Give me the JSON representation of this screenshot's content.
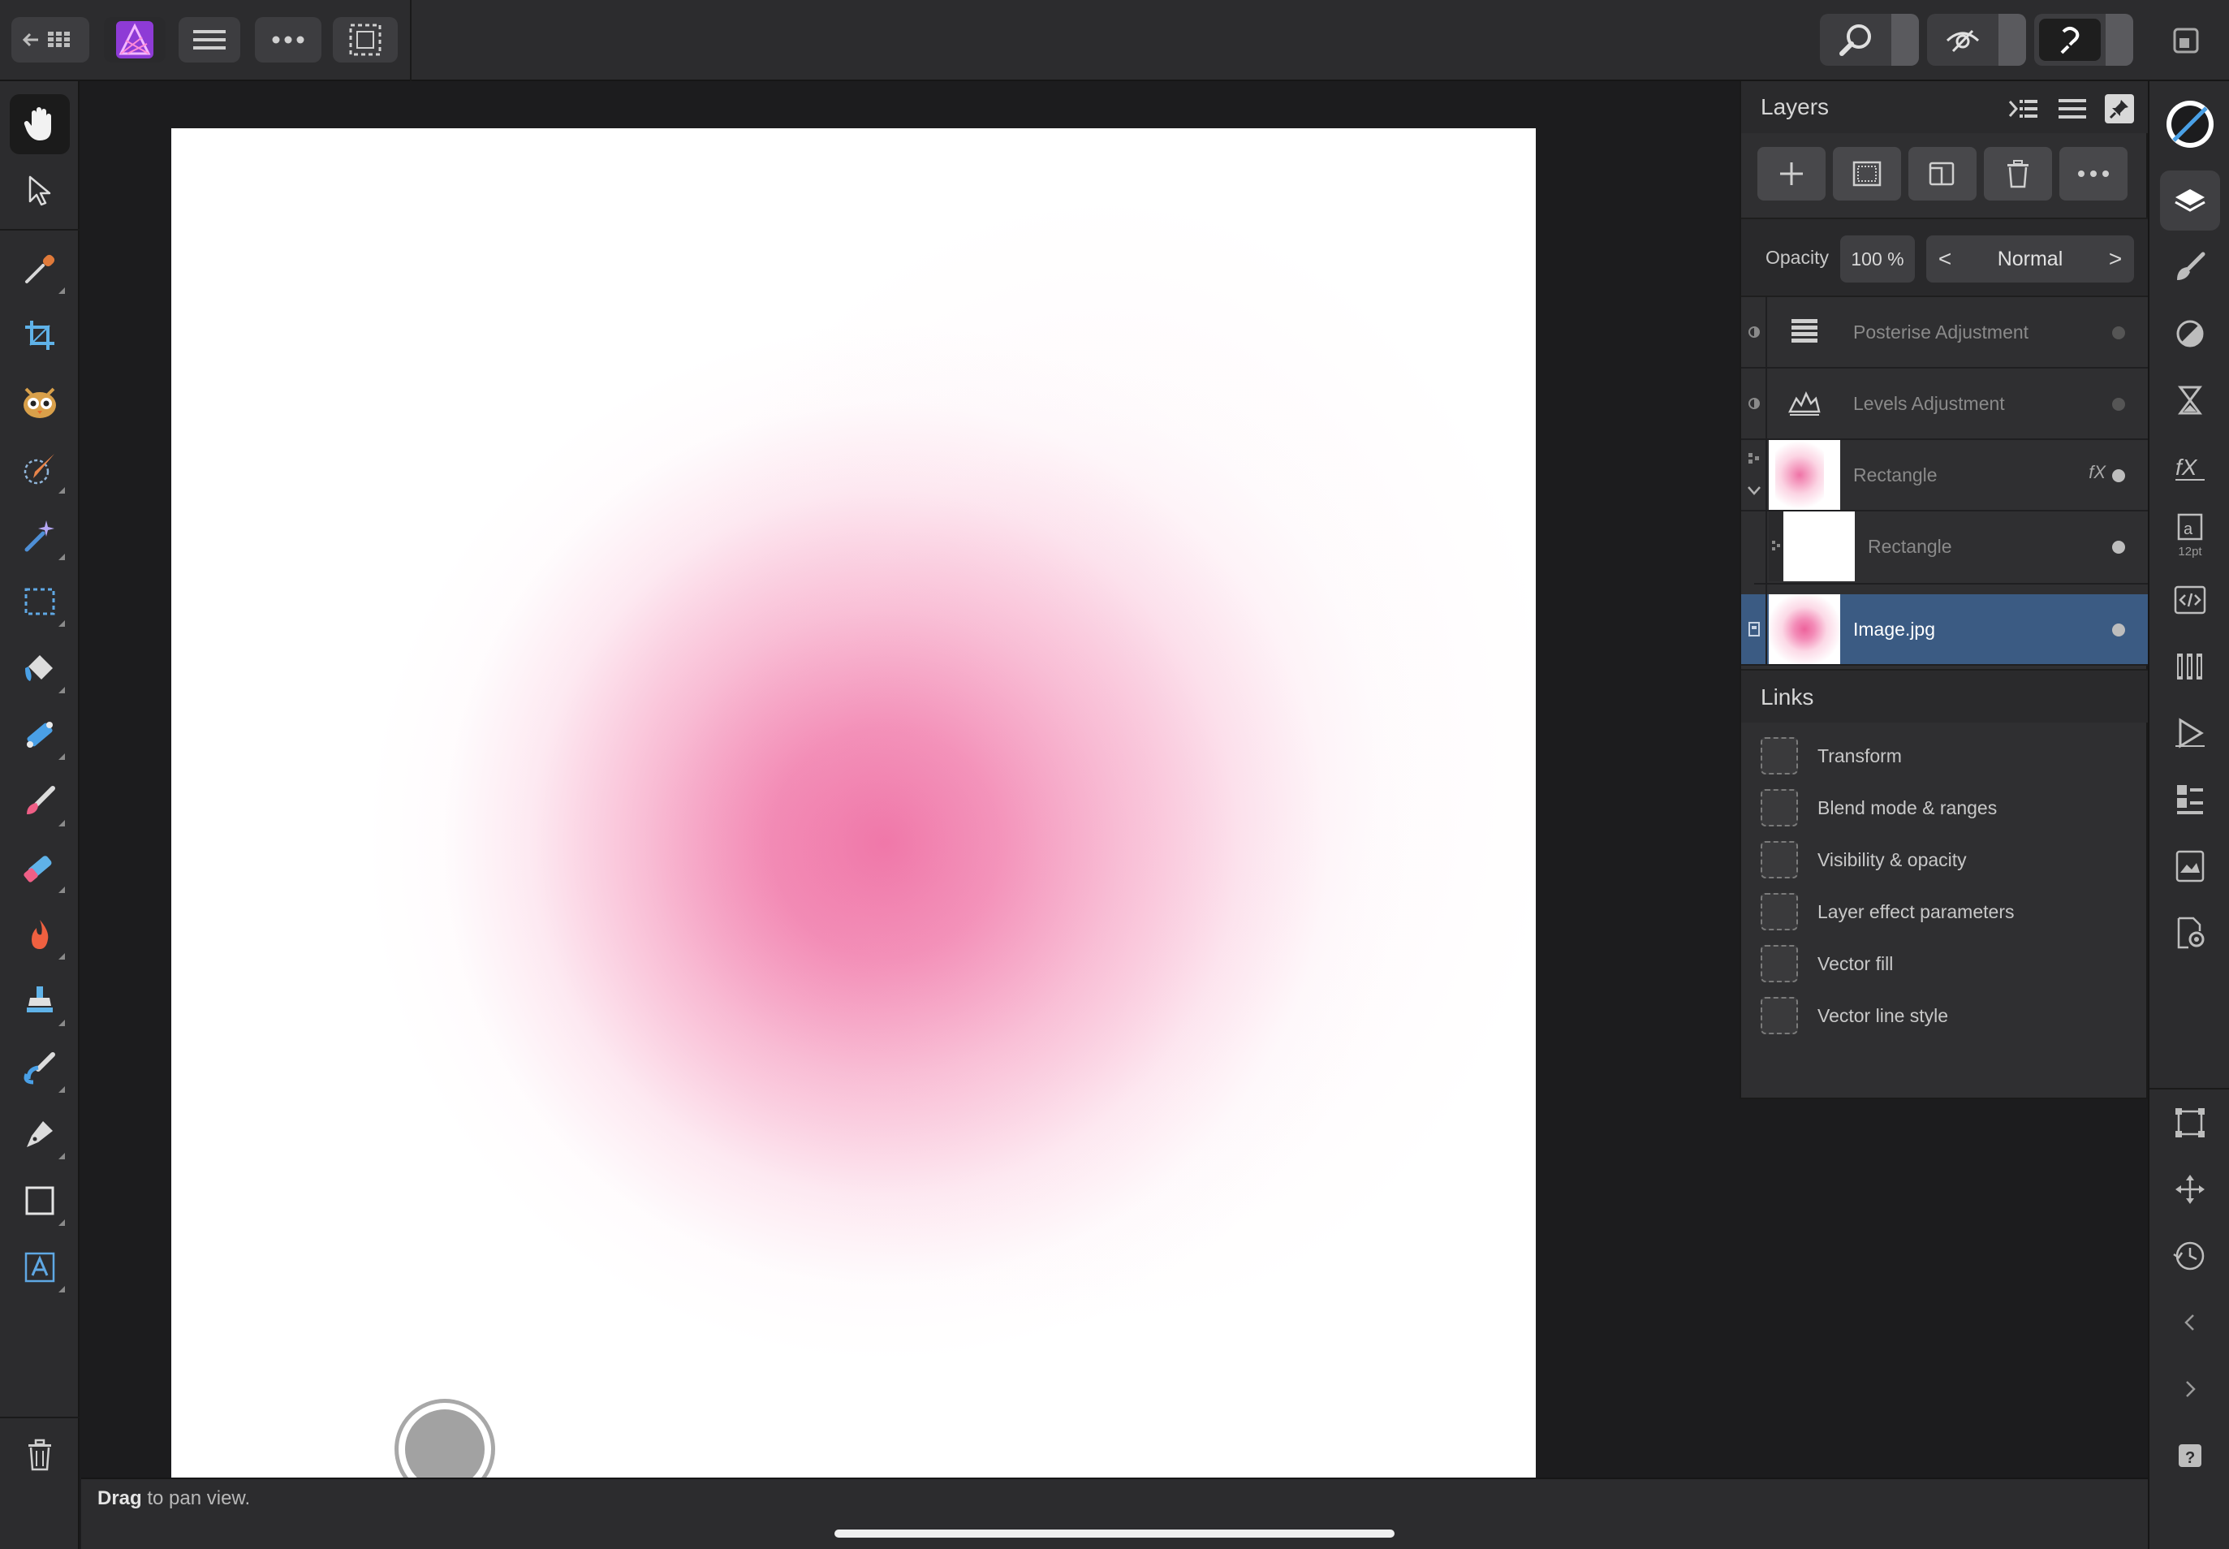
{
  "top_bar": {
    "back_grid_icon": "back-grid-icon",
    "app_icon": "affinity-photo-logo",
    "menu_icon": "hamburger-menu-icon",
    "more_icon": "ellipsis-icon",
    "selection_icon": "selection-marquee-icon",
    "right_groups": [
      "zoom-icon",
      "view-quality-icon",
      "snapping-assist-icon"
    ],
    "window_icon": "window-resize-icon"
  },
  "tools": [
    "hand-tool-icon",
    "move-tool-icon",
    "color-picker-tool-icon",
    "crop-tool-icon",
    "red-eye-tool-icon",
    "selection-brush-tool-icon",
    "flood-select-tool-icon",
    "marquee-tool-icon",
    "flood-fill-tool-icon",
    "gradient-tool-icon",
    "paint-brush-tool-icon",
    "erase-brush-tool-icon",
    "dodge-brush-tool-icon",
    "clone-brush-tool-icon",
    "smudge-brush-tool-icon",
    "pen-tool-icon",
    "rectangle-tool-icon",
    "artistic-text-tool-icon",
    "trash-icon"
  ],
  "layers_panel": {
    "title": "Layers",
    "opacity_label": "Opacity",
    "opacity_value": "100 %",
    "blend_mode": "Normal",
    "blend_prev": "<",
    "blend_next": ">",
    "layers": [
      {
        "name": "Posterise Adjustment",
        "kind": "adjustment"
      },
      {
        "name": "Levels Adjustment",
        "kind": "adjustment"
      },
      {
        "name": "Rectangle",
        "kind": "shape",
        "fx": "fX"
      },
      {
        "name": "Rectangle",
        "kind": "shape-child"
      },
      {
        "name": "Image.jpg",
        "kind": "image",
        "selected": true
      }
    ],
    "links_title": "Links",
    "links": [
      "Transform",
      "Blend mode & ranges",
      "Visibility & opacity",
      "Layer effect parameters",
      "Vector fill",
      "Vector line style"
    ]
  },
  "right_bar": {
    "text_size_badge": "12pt"
  },
  "status": {
    "bold": "Drag",
    "rest": " to pan view."
  },
  "colors": {
    "accent_selected": "#3b5b83",
    "canvas_blob": "#ec5a96",
    "panel_bg": "#2f2f31"
  }
}
